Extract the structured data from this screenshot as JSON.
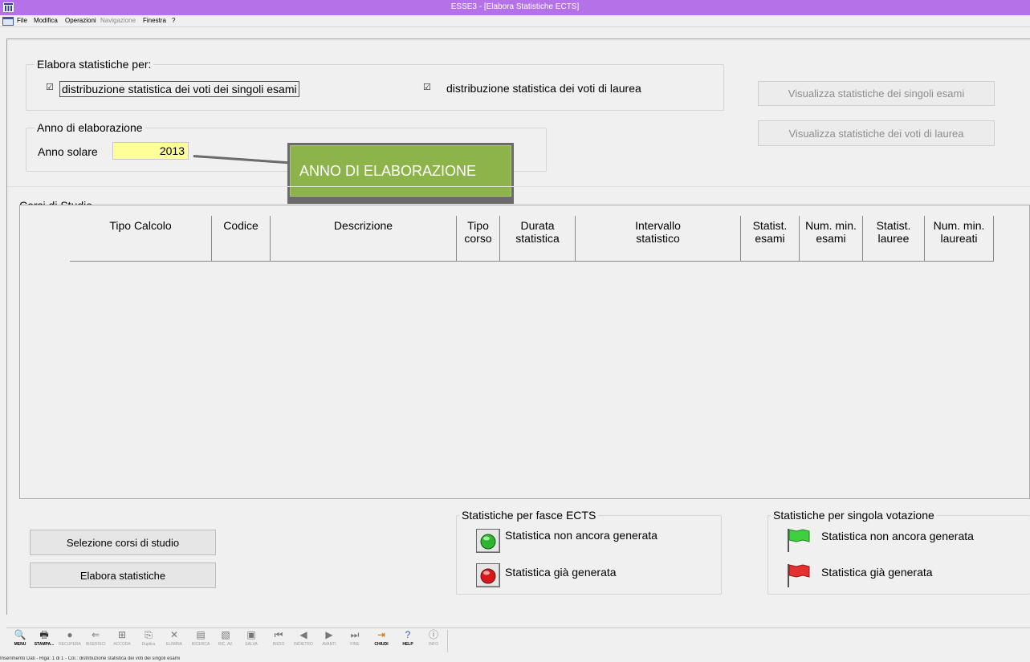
{
  "window": {
    "title": "ESSE3 - [Elabora Statistiche ECTS]"
  },
  "menu": {
    "file": "File",
    "modifica": "Modifica",
    "operazioni": "Operazioni",
    "navigazione": "Navigazione",
    "finestra": "Finestra",
    "help": "?"
  },
  "elabora": {
    "group_title": "Elabora statistiche per:",
    "check1_label": "distribuzione statistica dei voti dei singoli esami",
    "check1_checked": true,
    "check2_label": "distribuzione statistica dei voti di laurea",
    "check2_checked": true
  },
  "anno": {
    "group_title": "Anno di elaborazione",
    "label": "Anno solare",
    "value": "2013"
  },
  "callout": {
    "text": "ANNO DI ELABORAZIONE"
  },
  "buttons_right": {
    "view_esami": "Visualizza statistiche dei singoli esami",
    "view_lauree": "Visualizza statistiche dei voti di laurea"
  },
  "corsi": {
    "title": "Corsi di Studio",
    "columns": [
      {
        "line1": "Tipo Calcolo",
        "line2": ""
      },
      {
        "line1": "Codice",
        "line2": ""
      },
      {
        "line1": "Descrizione",
        "line2": ""
      },
      {
        "line1": "Tipo",
        "line2": "corso"
      },
      {
        "line1": "Durata",
        "line2": "statistica"
      },
      {
        "line1": "Intervallo",
        "line2": "statistico"
      },
      {
        "line1": "Statist.",
        "line2": "esami"
      },
      {
        "line1": "Num. min.",
        "line2": "esami"
      },
      {
        "line1": "Statist.",
        "line2": "lauree"
      },
      {
        "line1": "Num. min.",
        "line2": "laureati"
      }
    ]
  },
  "actions": {
    "selezione": "Selezione corsi di studio",
    "elabora": "Elabora statistiche"
  },
  "legend_ects": {
    "title": "Statistiche per fasce ECTS",
    "not_generated": "Statistica non ancora generata",
    "generated": "Statistica già generata",
    "colors": {
      "not_generated": "#2fb52f",
      "generated": "#d81818"
    }
  },
  "legend_voto": {
    "title": "Statistiche per singola votazione",
    "not_generated": "Statistica non ancora generata",
    "generated": "Statistica già generata",
    "colors": {
      "not_generated": "#3fcf3f",
      "generated": "#e63030"
    }
  },
  "toolbar": [
    {
      "label": "MENU",
      "icon": "menu-icon",
      "glyph": "🔍",
      "active": true
    },
    {
      "label": "STAMPA...",
      "icon": "print-icon",
      "glyph": "🖶",
      "active": true
    },
    {
      "label": "RECUPERA",
      "icon": "retrieve-icon",
      "glyph": "●",
      "active": false
    },
    {
      "label": "INSERISCI",
      "icon": "insert-icon",
      "glyph": "⇐",
      "active": false
    },
    {
      "label": "ACCODA",
      "icon": "append-icon",
      "glyph": "⊞",
      "active": false
    },
    {
      "label": "Duplica",
      "icon": "duplicate-icon",
      "glyph": "⎘",
      "active": false
    },
    {
      "label": "ELIMINA",
      "icon": "delete-icon",
      "glyph": "✕",
      "active": false
    },
    {
      "label": "RICERCA",
      "icon": "search-icon",
      "glyph": "▤",
      "active": false
    },
    {
      "label": "RIC. AV.",
      "icon": "advanced-search-icon",
      "glyph": "▧",
      "active": false
    },
    {
      "label": "SALVA",
      "icon": "save-icon",
      "glyph": "▣",
      "active": false
    },
    {
      "label": "INIZIO",
      "icon": "first-icon",
      "glyph": "⏮",
      "active": false
    },
    {
      "label": "INDIETRO",
      "icon": "prev-icon",
      "glyph": "◀",
      "active": false
    },
    {
      "label": "AVANTI",
      "icon": "next-icon",
      "glyph": "▶",
      "active": false
    },
    {
      "label": "FINE",
      "icon": "last-icon",
      "glyph": "⏭",
      "active": false
    },
    {
      "label": "CHIUDI",
      "icon": "close-icon",
      "glyph": "⇥",
      "active": true
    },
    {
      "label": "HELP",
      "icon": "help-icon",
      "glyph": "?",
      "active": true
    },
    {
      "label": "INFO",
      "icon": "info-icon",
      "glyph": "ⓘ",
      "active": false
    }
  ],
  "status": {
    "text": "Inserimento Dati - Riga: 1 di 1 - Col.: distribuzione statistica dei voti dei singoli esami"
  }
}
